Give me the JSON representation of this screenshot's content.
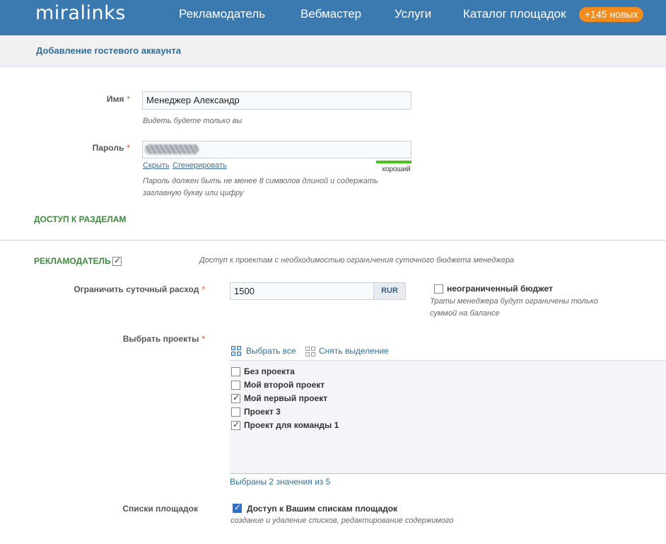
{
  "header": {
    "logo": "miralinks",
    "nav": [
      "Рекламодатель",
      "Вебмастер",
      "Услуги",
      "Каталог площадок"
    ],
    "badge": "+145 новых",
    "brand_color": "#3a7ab0",
    "badge_color": "#f28c1c"
  },
  "page": {
    "title": "Добавление гостевого аккаунта"
  },
  "form": {
    "name": {
      "label": "Имя",
      "required": "*",
      "value": "Менеджер Александр",
      "hint": "Видеть будете только вы"
    },
    "password": {
      "label": "Пароль",
      "required": "*",
      "hide_link": "Скрыть",
      "generate_link": "Сгенерировать",
      "strength": "хороший",
      "strength_level": 1.0,
      "hint": "Пароль должен быть не менее 8 символов длиной и содержать заглавную букву или цифру"
    }
  },
  "access": {
    "title": "ДОСТУП К РАЗДЕЛАМ",
    "advertiser": {
      "label": "РЕКЛАМОДАТЕЛЬ",
      "checked": true,
      "description": "Доступ к проектам с необходимостью ограничения суточного бюджета менеджера"
    },
    "daily_limit": {
      "label": "Ограничить суточный расход",
      "required": "*",
      "value": "1500",
      "currency": "RUR",
      "unlimited_label": "неограниченный бюджет",
      "unlimited_checked": false,
      "hint": "Траты менеджера будут ограничены только суммой на балансе"
    },
    "projects": {
      "label": "Выбрать проекты",
      "required": "*",
      "select_all": "Выбрать все",
      "deselect": "Снять выделение",
      "items": [
        {
          "name": "Без проекта",
          "checked": false
        },
        {
          "name": "Мой второй проект",
          "checked": false
        },
        {
          "name": "Мой первый проект",
          "checked": true
        },
        {
          "name": "Проект 3",
          "checked": false
        },
        {
          "name": "Проект для команды 1",
          "checked": true
        }
      ],
      "summary": "Выбраны 2 значения из 5"
    },
    "site_lists": {
      "label": "Списки площадок",
      "option": "Доступ к Вашим спискам площадок",
      "checked": true,
      "hint": "создание и удаление списков, редактирование содержимого"
    }
  }
}
